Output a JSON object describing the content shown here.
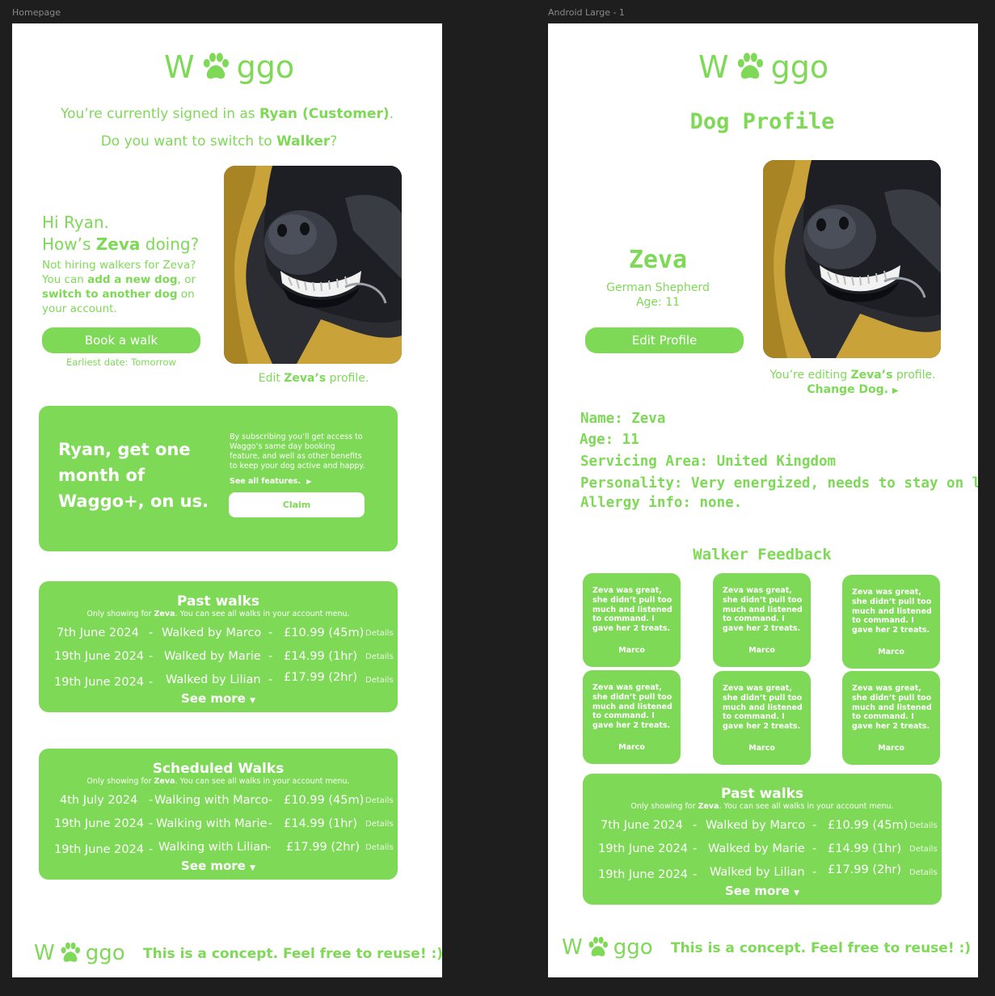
{
  "frames": {
    "homepage_label": "Homepage",
    "android_label": "Android Large - 1"
  },
  "colors": {
    "accent": "#7ed957",
    "canvas": "#1e1e1e",
    "page": "#ffffff"
  },
  "logo": {
    "left": "W",
    "right": "ggo",
    "icon": "paw-icon"
  },
  "homepage": {
    "signed_in_prefix": "You’re currently signed in as ",
    "signed_in_user": "Ryan (Customer)",
    "signed_in_suffix": ".",
    "switch_prefix": "Do you want to switch to ",
    "switch_role": "Walker",
    "switch_suffix": "?",
    "greeting_line1": "Hi Ryan.",
    "greeting_line2_prefix": "How’s ",
    "greeting_dog": "Zeva",
    "greeting_line2_suffix": " doing?",
    "hint_1": "Not hiring walkers for Zeva?",
    "hint_2": "You can ",
    "hint_add": "add a new dog",
    "hint_3": ", or",
    "hint_switch": "switch to another dog",
    "hint_4": " on",
    "hint_5": "your account.",
    "book_button": "Book a walk",
    "earliest_date": "Earliest date: Tomorrow",
    "edit_prefix": "Edit ",
    "edit_dog": "Zeva’s",
    "edit_suffix": " profile.",
    "promo": {
      "headline_1": "Ryan, get one",
      "headline_2": "month of",
      "headline_3": "Waggo+, on us.",
      "body_1": "By subscribing you’ll get access to",
      "body_2": "Waggo’s same day booking",
      "body_3": "feature, and well as other benefits",
      "body_4": "to keep your dog active and happy.",
      "see_all": "See all features.",
      "claim_button": "Claim"
    },
    "past_walks": {
      "title": "Past walks",
      "sub_prefix": "Only showing for ",
      "sub_dog": "Zeva",
      "sub_suffix": ". You can see all walks in your account menu.",
      "rows": [
        {
          "date": "7th June 2024",
          "walker": "Walked by Marco",
          "price": "£10.99 (45m)",
          "details": "Details"
        },
        {
          "date": "19th June 2024",
          "walker": "Walked by Marie",
          "price": "£14.99  (1hr)",
          "details": "Details"
        },
        {
          "date": "19th June 2024",
          "walker": "Walked by Lilian",
          "price": "£17.99 (2hr)",
          "details": "Details"
        }
      ],
      "see_more": "See more"
    },
    "scheduled_walks": {
      "title": "Scheduled Walks",
      "sub_prefix": "Only showing for ",
      "sub_dog": "Zeva",
      "sub_suffix": ". You can see all walks in your account menu.",
      "rows": [
        {
          "date": "4th July 2024",
          "walker": "Walking with Marco",
          "price": "£10.99 (45m)",
          "details": "Details"
        },
        {
          "date": "19th June 2024",
          "walker": "Walking with Marie",
          "price": "£14.99  (1hr)",
          "details": "Details"
        },
        {
          "date": "19th June 2024",
          "walker": "Walking with Lilian",
          "price": "£17.99 (2hr)",
          "details": "Details"
        }
      ],
      "see_more": "See more"
    },
    "dash": "-",
    "footer": "This is a concept. Feel free to reuse! :)"
  },
  "dog_profile": {
    "title": "Dog Profile",
    "name": "Zeva",
    "breed": "German Shepherd",
    "age": "Age: 11",
    "edit_button": "Edit Profile",
    "editing_prefix": "You’re editing ",
    "editing_dog": "Zeva’s",
    "editing_suffix": " profile.",
    "change_dog": "Change Dog.",
    "info": [
      "Name: Zeva",
      "Age: 11",
      "Servicing Area: United Kingdom",
      "Personality: Very energized, needs to stay on lead.",
      "Allergy info: none."
    ],
    "feedback_title": "Walker Feedback",
    "feedback": [
      {
        "text": "Zeva was great, she didn’t pull too much and listened to command. I gave her 2 treats.",
        "name": "Marco"
      },
      {
        "text": "Zeva was great, she didn’t pull too much and listened to command. I gave her 2 treats.",
        "name": "Marco"
      },
      {
        "text": "Zeva was great, she didn’t pull too much and listened to command. I gave her 2 treats.",
        "name": "Marco"
      },
      {
        "text": "Zeva was great, she didn’t pull too much and listened to command. I gave her 2 treats.",
        "name": "Marco"
      },
      {
        "text": "Zeva was great, she didn’t pull too much and listened to command. I gave her 2 treats.",
        "name": "Marco"
      },
      {
        "text": "Zeva was great, she didn’t pull too much and listened to command. I gave her 2 treats.",
        "name": "Marco"
      }
    ],
    "past_walks": {
      "title": "Past walks",
      "sub_prefix": "Only showing for ",
      "sub_dog": "Zeva",
      "sub_suffix": ". You can see all walks in your account menu.",
      "rows": [
        {
          "date": "7th June 2024",
          "walker": "Walked by Marco",
          "price": "£10.99 (45m)",
          "details": "Details"
        },
        {
          "date": "19th June 2024",
          "walker": "Walked by Marie",
          "price": "£14.99  (1hr)",
          "details": "Details"
        },
        {
          "date": "19th June 2024",
          "walker": "Walked by Lilian",
          "price": "£17.99 (2hr)",
          "details": "Details"
        }
      ],
      "see_more": "See more"
    },
    "footer": "This is a concept. Feel free to reuse! :)"
  }
}
